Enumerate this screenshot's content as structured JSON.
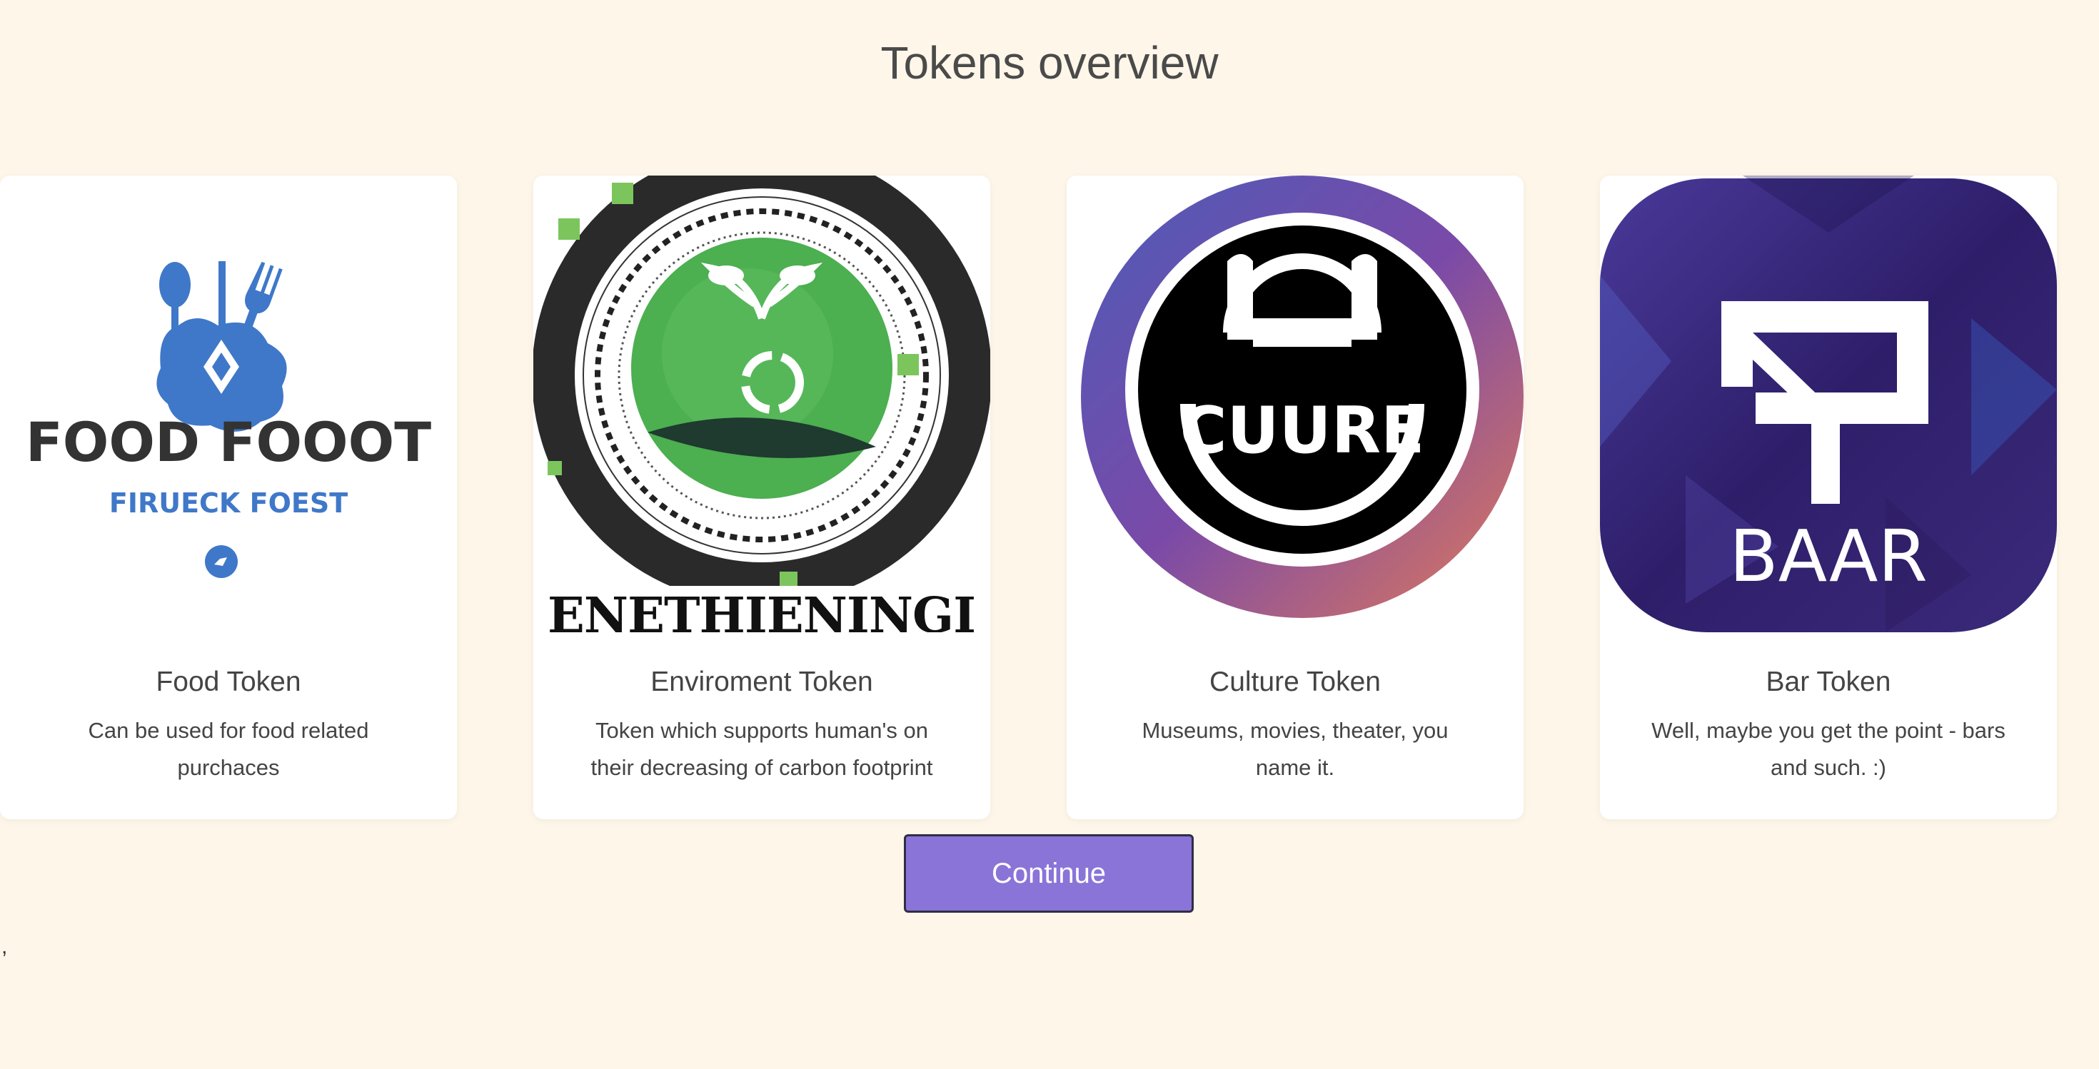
{
  "page": {
    "title": "Tokens overview",
    "stray_text": ","
  },
  "cards": [
    {
      "title": "Food Token",
      "description": "Can be used for food related purchaces",
      "image": {
        "icon": "food-logo",
        "line1": "FOOD FOOOT",
        "line2": "FIRUECK FOEST"
      }
    },
    {
      "title": "Enviroment Token",
      "description": "Token which supports human's on their decreasing of carbon footprint",
      "image": {
        "icon": "environment-logo",
        "line1": "ENETHIENINGI"
      }
    },
    {
      "title": "Culture Token",
      "description": "Museums, movies, theater, you name it.",
      "image": {
        "icon": "culture-logo",
        "line1": "CUURE"
      }
    },
    {
      "title": "Bar Token",
      "description": "Well, maybe you get the point - bars and such. :)",
      "image": {
        "icon": "bar-logo",
        "line1": "BAAR"
      }
    }
  ],
  "actions": {
    "continue_label": "Continue"
  },
  "colors": {
    "background": "#fdf6e9",
    "button": "#8a74d8",
    "food_blue": "#3f78c8",
    "env_green": "#4caf50",
    "bar_purple": "#3a2a7a"
  }
}
